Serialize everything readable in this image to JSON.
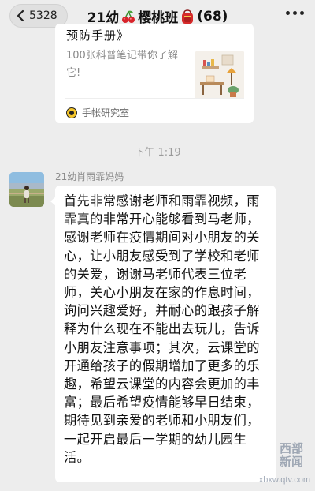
{
  "navbar": {
    "back_count": "5328",
    "title_prefix": "21幼",
    "title_suffix": "樱桃班",
    "member_count": "(68)"
  },
  "shared_card": {
    "title_cut": "预防手册》",
    "description": "100张科普笔记带你了解它!",
    "source": "手帐研究室"
  },
  "timestamp": "下午 1:19",
  "message": {
    "sender": "21幼肖雨霏妈妈",
    "text": "首先非常感谢老师和雨霏视频，雨霏真的非常开心能够看到马老师，感谢老师在疫情期间对小朋友的关心，让小朋友感受到了学校和老师的关爱，谢谢马老师代表三位老师，关心小朋友在家的作息时间，询问兴趣爱好，并耐心的跟孩子解释为什么现在不能出去玩儿，告诉小朋友注意事项；其次，云课堂的开通给孩子的假期增加了更多的乐趣，希望云课堂的内容会更加的丰富；最后希望疫情能够早日结束，期待见到亲爱的老师和小朋友们，一起开启最后一学期的幼儿园生活。"
  },
  "watermark": {
    "brand": "西部新闻",
    "url": "xbxw.qtv.com"
  },
  "colors": {
    "background": "#ededed",
    "bubble": "#ffffff",
    "secondary_text": "#8a8a8a"
  }
}
